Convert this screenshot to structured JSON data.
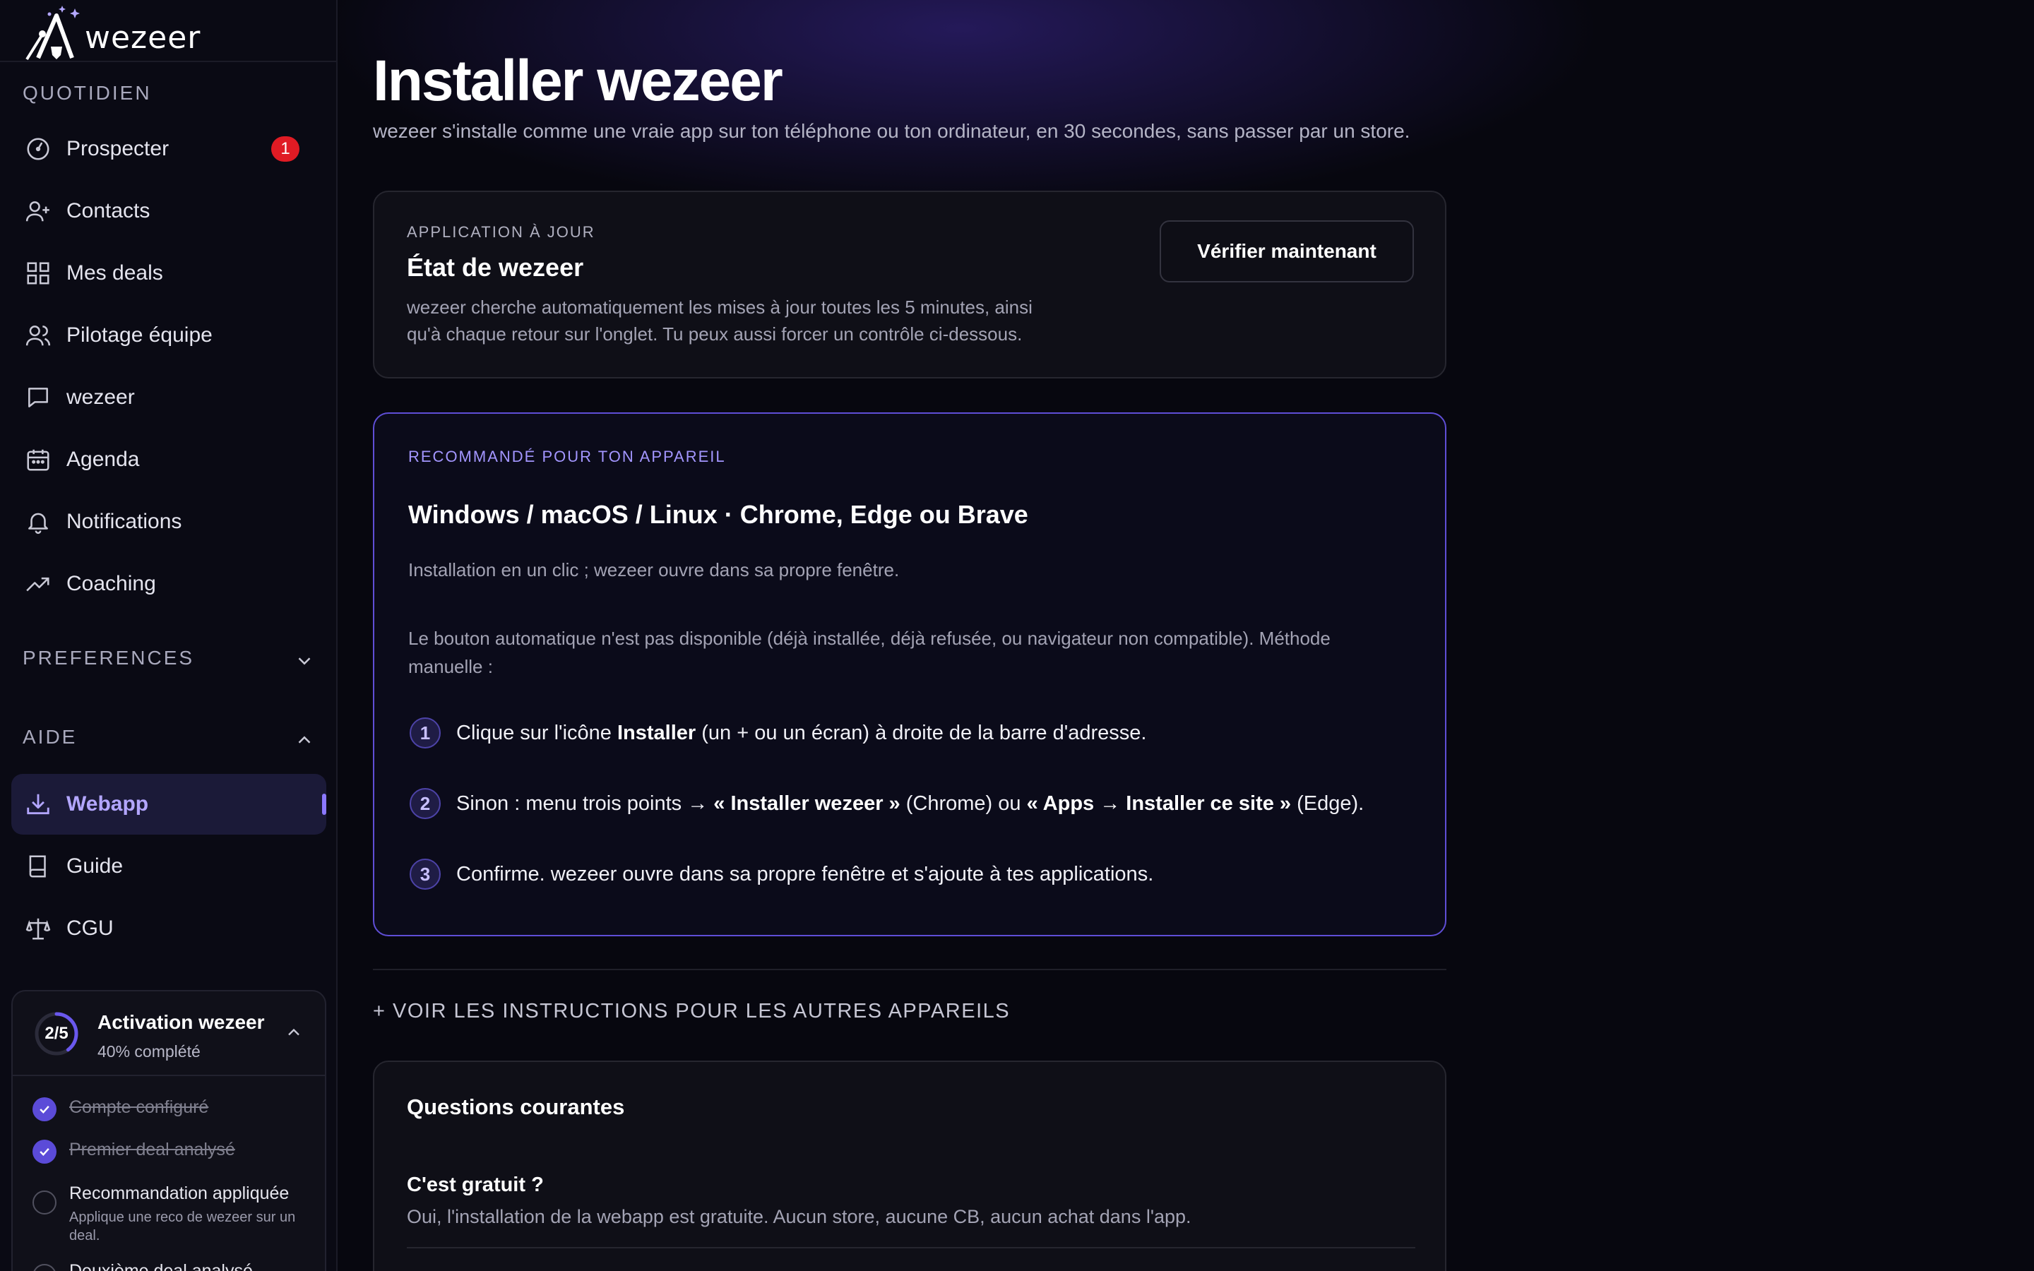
{
  "app": {
    "name": "wezeer"
  },
  "sidebar": {
    "sections": {
      "daily": "QUOTIDIEN",
      "preferences": "PREFERENCES",
      "help": "AIDE"
    },
    "daily_items": [
      {
        "label": "Prospecter",
        "icon": "compass-icon",
        "badge": "1"
      },
      {
        "label": "Contacts",
        "icon": "user-plus-icon"
      },
      {
        "label": "Mes deals",
        "icon": "grid-icon"
      },
      {
        "label": "Pilotage équipe",
        "icon": "users-icon"
      },
      {
        "label": "wezeer",
        "icon": "chat-icon"
      },
      {
        "label": "Agenda",
        "icon": "calendar-icon"
      },
      {
        "label": "Notifications",
        "icon": "bell-icon"
      },
      {
        "label": "Coaching",
        "icon": "trending-up-icon"
      }
    ],
    "help_items": [
      {
        "label": "Webapp",
        "icon": "download-icon",
        "active": true
      },
      {
        "label": "Guide",
        "icon": "book-icon"
      },
      {
        "label": "CGU",
        "icon": "scale-icon"
      }
    ],
    "activation": {
      "progress_text": "2/5",
      "progress_fraction": 0.4,
      "title": "Activation wezeer",
      "subtitle": "40% complété",
      "tasks": [
        {
          "label": "Compte configuré",
          "done": true
        },
        {
          "label": "Premier deal analysé",
          "done": true
        },
        {
          "label": "Recommandation appliquée",
          "sub": "Applique une reco de wezeer sur un deal.",
          "done": false
        },
        {
          "label": "Deuxième deal analysé",
          "done": false
        }
      ]
    }
  },
  "main": {
    "title": "Installer wezeer",
    "subtitle": "wezeer s'installe comme une vraie app sur ton téléphone ou ton ordinateur, en 30 secondes, sans passer par un store.",
    "status_card": {
      "eyebrow": "APPLICATION À JOUR",
      "title": "État de wezeer",
      "text_line1": "wezeer cherche automatiquement les mises à jour toutes les 5 minutes, ainsi",
      "text_line2": "qu'à chaque retour sur l'onglet. Tu peux aussi forcer un contrôle ci-dessous.",
      "button": "Vérifier maintenant"
    },
    "recommended_card": {
      "eyebrow": "RECOMMANDÉ POUR TON APPAREIL",
      "title": "Windows / macOS / Linux · Chrome, Edge ou Brave",
      "intro": "Installation en un clic ; wezeer ouvre dans sa propre fenêtre.",
      "manual_line1": "Le bouton automatique n'est pas disponible (déjà installée, déjà refusée, ou navigateur non compatible). Méthode",
      "manual_line2": "manuelle :",
      "steps": [
        {
          "num": "1",
          "pre": "Clique sur l'icône ",
          "bold1": "Installer",
          "mid": " (un + ou un écran) à droite de la barre d'adresse."
        },
        {
          "num": "2",
          "pre": "Sinon : menu trois points → ",
          "bold1": "« Installer wezeer »",
          "mid": " (Chrome) ou ",
          "bold2": "« Apps → Installer ce site »",
          "post": " (Edge)."
        },
        {
          "num": "3",
          "pre": "Confirme. wezeer ouvre dans sa propre fenêtre et s'ajoute à tes applications."
        }
      ]
    },
    "other_devices": "+ VOIR LES INSTRUCTIONS POUR LES AUTRES APPAREILS",
    "faq": {
      "title": "Questions courantes",
      "items": [
        {
          "q": "C'est gratuit ?",
          "a": "Oui, l'installation de la webapp est gratuite. Aucun store, aucune CB, aucun achat dans l'app."
        }
      ]
    }
  }
}
